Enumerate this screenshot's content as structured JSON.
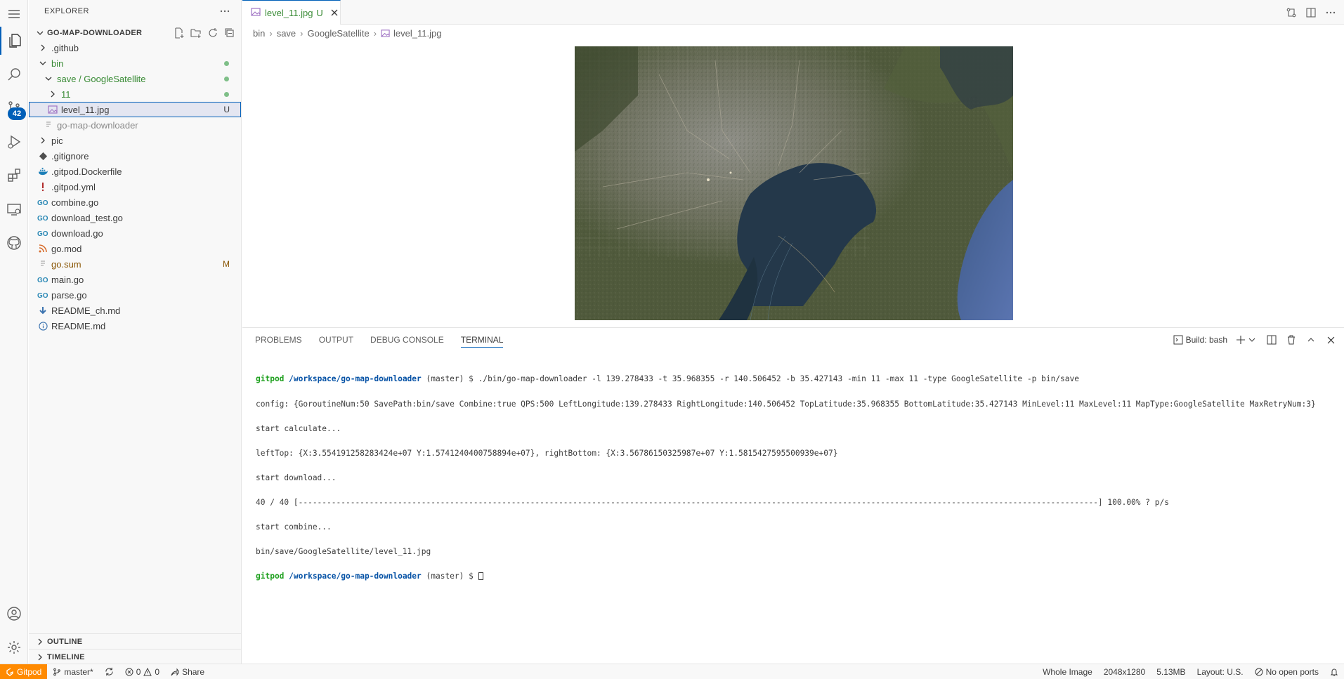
{
  "sidebar": {
    "title": "EXPLORER",
    "project": "GO-MAP-DOWNLOADER",
    "tree": [
      {
        "label": ".github",
        "icon": "chevron-right-icon",
        "indent": 1
      },
      {
        "label": "bin",
        "icon": "chevron-down-icon",
        "indent": 1,
        "color": "green",
        "dot": true
      },
      {
        "label": "save / GoogleSatellite",
        "icon": "chevron-down-icon",
        "indent": 2,
        "color": "green",
        "dot": true
      },
      {
        "label": "11",
        "icon": "chevron-right-icon",
        "indent": 3,
        "color": "green",
        "dot": true
      },
      {
        "label": "level_11.jpg",
        "icon": "image-file-icon",
        "indent": 3,
        "decoration": "U",
        "selected": true
      },
      {
        "label": "go-map-downloader",
        "icon": "file-icon",
        "indent": 2,
        "color": "muted"
      },
      {
        "label": "pic",
        "icon": "chevron-right-icon",
        "indent": 1
      },
      {
        "label": ".gitignore",
        "icon": "git-icon",
        "indent": 1
      },
      {
        "label": ".gitpod.Dockerfile",
        "icon": "docker-icon",
        "indent": 1
      },
      {
        "label": ".gitpod.yml",
        "icon": "yaml-icon",
        "indent": 1
      },
      {
        "label": "combine.go",
        "icon": "go-icon",
        "indent": 1
      },
      {
        "label": "download_test.go",
        "icon": "go-icon",
        "indent": 1
      },
      {
        "label": "download.go",
        "icon": "go-icon",
        "indent": 1
      },
      {
        "label": "go.mod",
        "icon": "rss-icon",
        "indent": 1
      },
      {
        "label": "go.sum",
        "icon": "file-lines-icon",
        "indent": 1,
        "color": "brown",
        "decoration": "M"
      },
      {
        "label": "main.go",
        "icon": "go-icon",
        "indent": 1
      },
      {
        "label": "parse.go",
        "icon": "go-icon",
        "indent": 1
      },
      {
        "label": "README_ch.md",
        "icon": "markdown-icon",
        "indent": 1
      },
      {
        "label": "README.md",
        "icon": "info-icon",
        "indent": 1
      }
    ],
    "outline": "OUTLINE",
    "timeline": "TIMELINE"
  },
  "activity": {
    "scm_badge": "42"
  },
  "editor": {
    "tab": {
      "label": "level_11.jpg",
      "decoration": "U"
    },
    "breadcrumb": [
      "bin",
      "save",
      "GoogleSatellite",
      "level_11.jpg"
    ]
  },
  "panel": {
    "tabs": [
      "PROBLEMS",
      "OUTPUT",
      "DEBUG CONSOLE",
      "TERMINAL"
    ],
    "active_tab": "TERMINAL",
    "terminal_name": "Build: bash",
    "prompt_user": "gitpod",
    "prompt_path": "/workspace/go-map-downloader",
    "prompt_branch": " (master) $ ",
    "command": "./bin/go-map-downloader -l 139.278433 -t 35.968355 -r 140.506452 -b 35.427143 -min 11 -max 11 -type GoogleSatellite -p bin/save",
    "output": [
      "config: {GoroutineNum:50 SavePath:bin/save Combine:true QPS:500 LeftLongitude:139.278433 RightLongitude:140.506452 TopLatitude:35.968355 BottomLatitude:35.427143 MinLevel:11 MaxLevel:11 MapType:GoogleSatellite MaxRetryNum:3}",
      "start calculate...",
      "leftTop: {X:3.554191258283424e+07 Y:1.5741240400758894e+07}, rightBottom: {X:3.56786150325987e+07 Y:1.5815427595500939e+07}",
      "start download...",
      "40 / 40 [-------------------------------------------------------------------------------------------------------------------------------------------------------------------------] 100.00% ? p/s",
      "start combine...",
      "bin/save/GoogleSatellite/level_11.jpg"
    ]
  },
  "status": {
    "gitpod": "Gitpod",
    "branch": "master*",
    "errors": "0",
    "warnings": "0",
    "share": "Share",
    "image_kind": "Whole Image",
    "dimensions": "2048x1280",
    "size": "5.13MB",
    "layout": "Layout: U.S.",
    "ports": "No open ports"
  },
  "colors": {
    "accent": "#005fb8",
    "gitpod": "#ff8a00",
    "untracked": "#388a34",
    "modified": "#895503"
  }
}
